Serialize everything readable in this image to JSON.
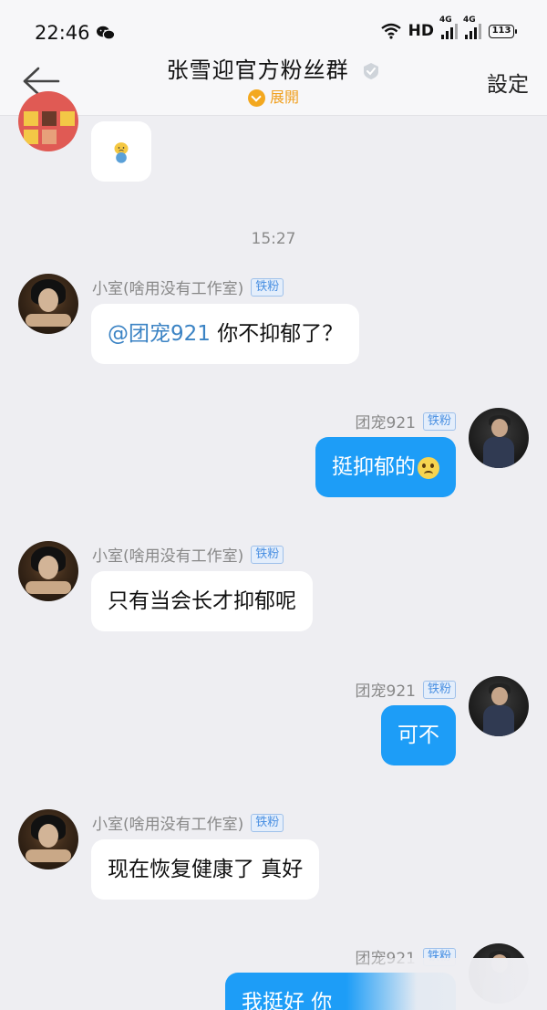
{
  "status_bar": {
    "time": "22:46",
    "hd": "HD",
    "net1": "4G",
    "net2": "4G",
    "battery": "113"
  },
  "header": {
    "title": "张雪迎官方粉丝群",
    "expand_label": "展開",
    "settings_label": "設定"
  },
  "chat": {
    "time_divider": "15:27",
    "messages": [
      {
        "sender": "小室(啥用没有工作室)",
        "badge": "铁粉",
        "mention": "@团宠921",
        "text": " 你不抑郁了？"
      },
      {
        "sender": "团宠921",
        "badge": "铁粉",
        "text": "挺抑郁的"
      },
      {
        "sender": "小室(啥用没有工作室)",
        "badge": "铁粉",
        "text": "只有当会长才抑郁呢"
      },
      {
        "sender": "团宠921",
        "badge": "铁粉",
        "text": "可不"
      },
      {
        "sender": "小室(啥用没有工作室)",
        "badge": "铁粉",
        "text": "现在恢复健康了 真好"
      },
      {
        "sender": "团宠921",
        "badge": "铁粉",
        "text": "我挺好 你"
      }
    ]
  },
  "colors": {
    "outgoing_bubble": "#1d9df7",
    "incoming_bubble": "#ffffff",
    "background": "#eeeef2",
    "badge_blue": "#4a90e2",
    "expand_orange": "#f3a81f"
  }
}
